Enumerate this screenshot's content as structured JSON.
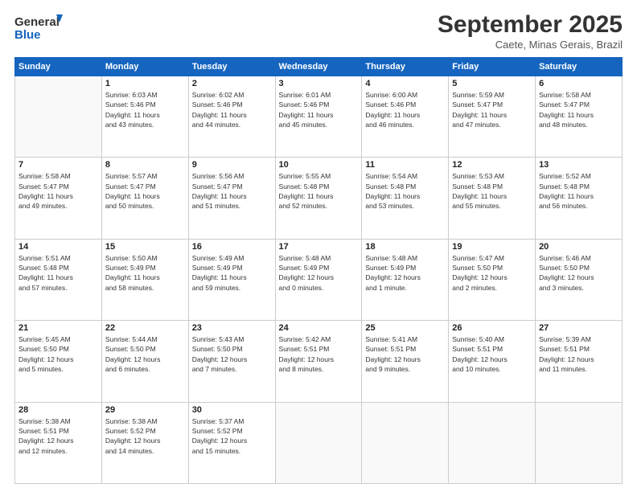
{
  "header": {
    "logo_line1": "General",
    "logo_line2": "Blue",
    "month": "September 2025",
    "location": "Caete, Minas Gerais, Brazil"
  },
  "weekdays": [
    "Sunday",
    "Monday",
    "Tuesday",
    "Wednesday",
    "Thursday",
    "Friday",
    "Saturday"
  ],
  "weeks": [
    [
      {
        "day": "",
        "info": ""
      },
      {
        "day": "1",
        "info": "Sunrise: 6:03 AM\nSunset: 5:46 PM\nDaylight: 11 hours\nand 43 minutes."
      },
      {
        "day": "2",
        "info": "Sunrise: 6:02 AM\nSunset: 5:46 PM\nDaylight: 11 hours\nand 44 minutes."
      },
      {
        "day": "3",
        "info": "Sunrise: 6:01 AM\nSunset: 5:46 PM\nDaylight: 11 hours\nand 45 minutes."
      },
      {
        "day": "4",
        "info": "Sunrise: 6:00 AM\nSunset: 5:46 PM\nDaylight: 11 hours\nand 46 minutes."
      },
      {
        "day": "5",
        "info": "Sunrise: 5:59 AM\nSunset: 5:47 PM\nDaylight: 11 hours\nand 47 minutes."
      },
      {
        "day": "6",
        "info": "Sunrise: 5:58 AM\nSunset: 5:47 PM\nDaylight: 11 hours\nand 48 minutes."
      }
    ],
    [
      {
        "day": "7",
        "info": "Sunrise: 5:58 AM\nSunset: 5:47 PM\nDaylight: 11 hours\nand 49 minutes."
      },
      {
        "day": "8",
        "info": "Sunrise: 5:57 AM\nSunset: 5:47 PM\nDaylight: 11 hours\nand 50 minutes."
      },
      {
        "day": "9",
        "info": "Sunrise: 5:56 AM\nSunset: 5:47 PM\nDaylight: 11 hours\nand 51 minutes."
      },
      {
        "day": "10",
        "info": "Sunrise: 5:55 AM\nSunset: 5:48 PM\nDaylight: 11 hours\nand 52 minutes."
      },
      {
        "day": "11",
        "info": "Sunrise: 5:54 AM\nSunset: 5:48 PM\nDaylight: 11 hours\nand 53 minutes."
      },
      {
        "day": "12",
        "info": "Sunrise: 5:53 AM\nSunset: 5:48 PM\nDaylight: 11 hours\nand 55 minutes."
      },
      {
        "day": "13",
        "info": "Sunrise: 5:52 AM\nSunset: 5:48 PM\nDaylight: 11 hours\nand 56 minutes."
      }
    ],
    [
      {
        "day": "14",
        "info": "Sunrise: 5:51 AM\nSunset: 5:48 PM\nDaylight: 11 hours\nand 57 minutes."
      },
      {
        "day": "15",
        "info": "Sunrise: 5:50 AM\nSunset: 5:49 PM\nDaylight: 11 hours\nand 58 minutes."
      },
      {
        "day": "16",
        "info": "Sunrise: 5:49 AM\nSunset: 5:49 PM\nDaylight: 11 hours\nand 59 minutes."
      },
      {
        "day": "17",
        "info": "Sunrise: 5:48 AM\nSunset: 5:49 PM\nDaylight: 12 hours\nand 0 minutes."
      },
      {
        "day": "18",
        "info": "Sunrise: 5:48 AM\nSunset: 5:49 PM\nDaylight: 12 hours\nand 1 minute."
      },
      {
        "day": "19",
        "info": "Sunrise: 5:47 AM\nSunset: 5:50 PM\nDaylight: 12 hours\nand 2 minutes."
      },
      {
        "day": "20",
        "info": "Sunrise: 5:46 AM\nSunset: 5:50 PM\nDaylight: 12 hours\nand 3 minutes."
      }
    ],
    [
      {
        "day": "21",
        "info": "Sunrise: 5:45 AM\nSunset: 5:50 PM\nDaylight: 12 hours\nand 5 minutes."
      },
      {
        "day": "22",
        "info": "Sunrise: 5:44 AM\nSunset: 5:50 PM\nDaylight: 12 hours\nand 6 minutes."
      },
      {
        "day": "23",
        "info": "Sunrise: 5:43 AM\nSunset: 5:50 PM\nDaylight: 12 hours\nand 7 minutes."
      },
      {
        "day": "24",
        "info": "Sunrise: 5:42 AM\nSunset: 5:51 PM\nDaylight: 12 hours\nand 8 minutes."
      },
      {
        "day": "25",
        "info": "Sunrise: 5:41 AM\nSunset: 5:51 PM\nDaylight: 12 hours\nand 9 minutes."
      },
      {
        "day": "26",
        "info": "Sunrise: 5:40 AM\nSunset: 5:51 PM\nDaylight: 12 hours\nand 10 minutes."
      },
      {
        "day": "27",
        "info": "Sunrise: 5:39 AM\nSunset: 5:51 PM\nDaylight: 12 hours\nand 11 minutes."
      }
    ],
    [
      {
        "day": "28",
        "info": "Sunrise: 5:38 AM\nSunset: 5:51 PM\nDaylight: 12 hours\nand 12 minutes."
      },
      {
        "day": "29",
        "info": "Sunrise: 5:38 AM\nSunset: 5:52 PM\nDaylight: 12 hours\nand 14 minutes."
      },
      {
        "day": "30",
        "info": "Sunrise: 5:37 AM\nSunset: 5:52 PM\nDaylight: 12 hours\nand 15 minutes."
      },
      {
        "day": "",
        "info": ""
      },
      {
        "day": "",
        "info": ""
      },
      {
        "day": "",
        "info": ""
      },
      {
        "day": "",
        "info": ""
      }
    ]
  ]
}
